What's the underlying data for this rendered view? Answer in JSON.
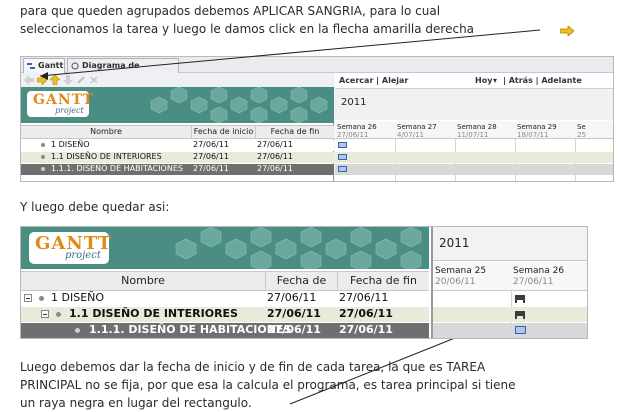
{
  "paragraphs": {
    "intro_line1": "para que queden agrupados debemos APLICAR SANGRIA, para lo cual",
    "intro_line2": "seleccionamos la tarea y luego le damos click en la flecha amarilla derecha",
    "after_line": "Y luego debe quedar asi:",
    "final_line1": "Luego debemos dar la fecha de inicio  y de fin de cada tarea, la que es TAREA",
    "final_line2": "PRINCIPAL no se fija, por que esa la calcula el programa, es tarea principal si tiene",
    "final_line3": "un raya negra en lugar del rectangulo."
  },
  "icons": {
    "yellow_arrow": "right-arrow-icon"
  },
  "colors": {
    "banner_teal": "#4a8d82",
    "selected_row": "#6f6f6f",
    "highlight_row": "#e8ebd9",
    "task_bar": "#a8c8ec"
  },
  "shot1": {
    "tabs": [
      "Gantt",
      "Diagrama de recursos"
    ],
    "logo_word": "GANTT",
    "logo_sub": "project",
    "columns": {
      "name": "Nombre",
      "start": "Fecha de inicio",
      "end": "Fecha de fin"
    },
    "rows": [
      {
        "name": "1 DISEÑO",
        "start": "27/06/11",
        "end": "27/06/11"
      },
      {
        "name": "1.1 DISEÑO DE INTERIORES",
        "start": "27/06/11",
        "end": "27/06/11"
      },
      {
        "name": "1.1.1. DISEÑO DE HABITACIONES",
        "start": "27/06/11",
        "end": "27/06/11"
      }
    ],
    "nav": {
      "zoom": "Acercar | Alejar",
      "today": "Hoy",
      "back_forward": "| Atrás | Adelante"
    },
    "year": "2011",
    "weeks": [
      {
        "label": "Semana 26",
        "date": "27/06/11"
      },
      {
        "label": "Semana 27",
        "date": "4/07/11"
      },
      {
        "label": "Semana 28",
        "date": "11/07/11"
      },
      {
        "label": "Semana 29",
        "date": "18/07/11"
      },
      {
        "label": "Se",
        "date": "25"
      }
    ]
  },
  "shot2": {
    "logo_word": "GANTT",
    "logo_sub": "project",
    "columns": {
      "name": "Nombre",
      "start": "Fecha de ini...",
      "end": "Fecha de fin"
    },
    "rows": [
      {
        "name": "1 DISEÑO",
        "start": "27/06/11",
        "end": "27/06/11"
      },
      {
        "name": "1.1 DISEÑO DE INTERIORES",
        "start": "27/06/11",
        "end": "27/06/11"
      },
      {
        "name": "1.1.1. DISEÑO DE HABITACIONES",
        "start": "27/06/11",
        "end": "27/06/11"
      }
    ],
    "year": "2011",
    "weeks": [
      {
        "label": "Semana 25",
        "date": "20/06/11"
      },
      {
        "label": "Semana 26",
        "date": "27/06/11"
      }
    ]
  }
}
